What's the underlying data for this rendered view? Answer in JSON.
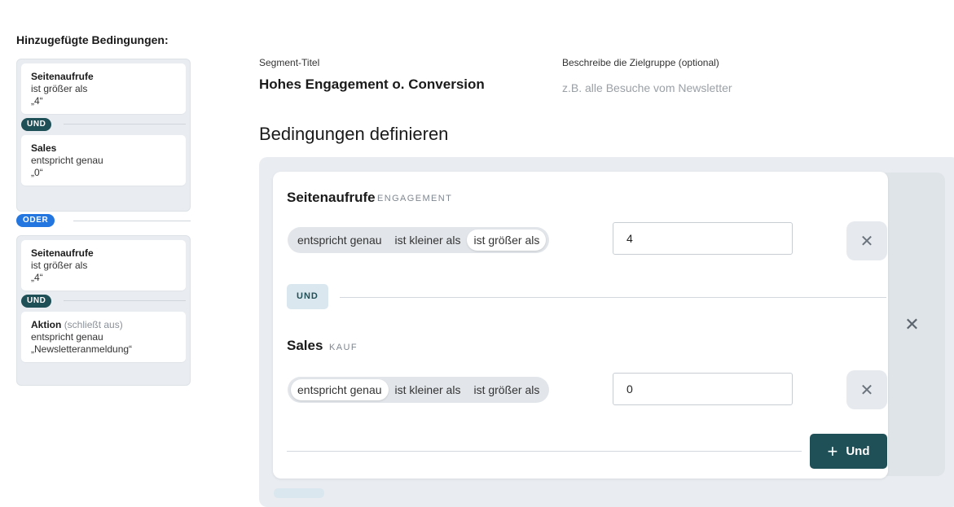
{
  "sidebar": {
    "title": "Hinzugefügte Bedingungen:",
    "group1": {
      "card1": {
        "metric": "Seitenaufrufe",
        "operator": "ist größer als",
        "value": "„4“"
      },
      "connector": "UND",
      "card2": {
        "metric": "Sales",
        "operator": "entspricht genau",
        "value": "„0“"
      }
    },
    "or_connector": "ODER",
    "group2": {
      "card1": {
        "metric": "Seitenaufrufe",
        "operator": "ist größer als",
        "value": "„4“"
      },
      "connector": "UND",
      "card2": {
        "metric": "Aktion",
        "note": "(schließt aus)",
        "operator": "entspricht genau",
        "value": "„Newsletteranmeldung“"
      }
    }
  },
  "header": {
    "segment_title_label": "Segment-Titel",
    "segment_title": "Hohes Engagement o. Conversion",
    "description_label": "Beschreibe die Zielgruppe (optional)",
    "description_placeholder": "z.B. alle Besuche vom Newsletter",
    "section_heading": "Bedingungen definieren"
  },
  "rules": [
    {
      "metric": "Seitenaufrufe",
      "category": "ENGAGEMENT",
      "operators": [
        "entspricht genau",
        "ist kleiner als",
        "ist größer als"
      ],
      "selected_operator": "ist größer als",
      "value": "4"
    },
    {
      "metric": "Sales",
      "category": "KAUF",
      "operators": [
        "entspricht genau",
        "ist kleiner als",
        "ist größer als"
      ],
      "selected_operator": "entspricht genau",
      "value": "0"
    }
  ],
  "und_tag": "UND",
  "add_button_label": "Und",
  "icons": {
    "remove": "close-icon",
    "add": "plus-icon"
  },
  "colors": {
    "accent_dark_teal": "#1f4f57",
    "oder_blue": "#2376e0",
    "panel_gray": "#e9edf1"
  }
}
